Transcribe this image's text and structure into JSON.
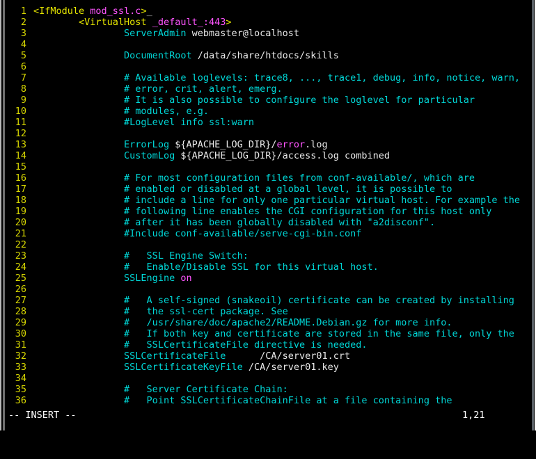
{
  "app": {
    "name": "vim",
    "mode_label": "-- INSERT --",
    "cursor_position": "1,21",
    "background_color": "#000000",
    "line_number_color": "#d7d700",
    "comment_color": "#00d7d7",
    "tag_color": "#e5e500",
    "value_color": "#ff55ff",
    "text_color": "#e8e8e8"
  },
  "scrollbars": {
    "left": {
      "name": "left-scrollbar",
      "thumb_color": "#6f6f6f"
    },
    "right": {
      "name": "right-scrollbar",
      "thumb_color": "#5a6066"
    }
  },
  "editor": {
    "first_line_number": 1,
    "last_line_number": 36,
    "lines": [
      {
        "n": "1",
        "tokens": [
          {
            "t": "plain",
            "s": ""
          },
          {
            "t": "tag",
            "s": "<IfModule "
          },
          {
            "t": "ident",
            "s": "mod_ssl.c"
          },
          {
            "t": "tag",
            "s": ">"
          },
          {
            "t": "cursor",
            "s": "_"
          }
        ]
      },
      {
        "n": "2",
        "tokens": [
          {
            "t": "plain",
            "s": "        "
          },
          {
            "t": "tag",
            "s": "<VirtualHost "
          },
          {
            "t": "ident",
            "s": "_default_:443"
          },
          {
            "t": "tag",
            "s": ">"
          }
        ]
      },
      {
        "n": "3",
        "tokens": [
          {
            "t": "plain",
            "s": "                "
          },
          {
            "t": "dir",
            "s": "ServerAdmin"
          },
          {
            "t": "plain",
            "s": " webmaster@localhost"
          }
        ]
      },
      {
        "n": "4",
        "tokens": [
          {
            "t": "plain",
            "s": ""
          }
        ]
      },
      {
        "n": "5",
        "tokens": [
          {
            "t": "plain",
            "s": "                "
          },
          {
            "t": "dir",
            "s": "DocumentRoot"
          },
          {
            "t": "plain",
            "s": " /data/share/htdocs/skills"
          }
        ]
      },
      {
        "n": "6",
        "tokens": [
          {
            "t": "plain",
            "s": ""
          }
        ]
      },
      {
        "n": "7",
        "tokens": [
          {
            "t": "plain",
            "s": "                "
          },
          {
            "t": "comment",
            "s": "# Available loglevels: trace8, ..., trace1, debug, info, notice, warn,"
          }
        ]
      },
      {
        "n": "8",
        "tokens": [
          {
            "t": "plain",
            "s": "                "
          },
          {
            "t": "comment",
            "s": "# error, crit, alert, emerg."
          }
        ]
      },
      {
        "n": "9",
        "tokens": [
          {
            "t": "plain",
            "s": "                "
          },
          {
            "t": "comment",
            "s": "# It is also possible to configure the loglevel for particular"
          }
        ]
      },
      {
        "n": "10",
        "tokens": [
          {
            "t": "plain",
            "s": "                "
          },
          {
            "t": "comment",
            "s": "# modules, e.g."
          }
        ]
      },
      {
        "n": "11",
        "tokens": [
          {
            "t": "plain",
            "s": "                "
          },
          {
            "t": "comment",
            "s": "#LogLevel info ssl:warn"
          }
        ]
      },
      {
        "n": "12",
        "tokens": [
          {
            "t": "plain",
            "s": ""
          }
        ]
      },
      {
        "n": "13",
        "tokens": [
          {
            "t": "plain",
            "s": "                "
          },
          {
            "t": "dir",
            "s": "ErrorLog"
          },
          {
            "t": "plain",
            "s": " ${APACHE_LOG_DIR}/"
          },
          {
            "t": "val",
            "s": "error"
          },
          {
            "t": "plain",
            "s": ".log"
          }
        ]
      },
      {
        "n": "14",
        "tokens": [
          {
            "t": "plain",
            "s": "                "
          },
          {
            "t": "dir",
            "s": "CustomLog"
          },
          {
            "t": "plain",
            "s": " ${APACHE_LOG_DIR}/access.log combined"
          }
        ]
      },
      {
        "n": "15",
        "tokens": [
          {
            "t": "plain",
            "s": ""
          }
        ]
      },
      {
        "n": "16",
        "tokens": [
          {
            "t": "plain",
            "s": "                "
          },
          {
            "t": "comment",
            "s": "# For most configuration files from conf-available/, which are"
          }
        ]
      },
      {
        "n": "17",
        "tokens": [
          {
            "t": "plain",
            "s": "                "
          },
          {
            "t": "comment",
            "s": "# enabled or disabled at a global level, it is possible to"
          }
        ]
      },
      {
        "n": "18",
        "tokens": [
          {
            "t": "plain",
            "s": "                "
          },
          {
            "t": "comment",
            "s": "# include a line for only one particular virtual host. For example the"
          }
        ]
      },
      {
        "n": "19",
        "tokens": [
          {
            "t": "plain",
            "s": "                "
          },
          {
            "t": "comment",
            "s": "# following line enables the CGI configuration for this host only"
          }
        ]
      },
      {
        "n": "20",
        "tokens": [
          {
            "t": "plain",
            "s": "                "
          },
          {
            "t": "comment",
            "s": "# after it has been globally disabled with \"a2disconf\"."
          }
        ]
      },
      {
        "n": "21",
        "tokens": [
          {
            "t": "plain",
            "s": "                "
          },
          {
            "t": "comment",
            "s": "#Include conf-available/serve-cgi-bin.conf"
          }
        ]
      },
      {
        "n": "22",
        "tokens": [
          {
            "t": "plain",
            "s": ""
          }
        ]
      },
      {
        "n": "23",
        "tokens": [
          {
            "t": "plain",
            "s": "                "
          },
          {
            "t": "comment",
            "s": "#   SSL Engine Switch:"
          }
        ]
      },
      {
        "n": "24",
        "tokens": [
          {
            "t": "plain",
            "s": "                "
          },
          {
            "t": "comment",
            "s": "#   Enable/Disable SSL for this virtual host."
          }
        ]
      },
      {
        "n": "25",
        "tokens": [
          {
            "t": "plain",
            "s": "                "
          },
          {
            "t": "dir",
            "s": "SSLEngine"
          },
          {
            "t": "plain",
            "s": " "
          },
          {
            "t": "val",
            "s": "on"
          }
        ]
      },
      {
        "n": "26",
        "tokens": [
          {
            "t": "plain",
            "s": ""
          }
        ]
      },
      {
        "n": "27",
        "tokens": [
          {
            "t": "plain",
            "s": "                "
          },
          {
            "t": "comment",
            "s": "#   A self-signed (snakeoil) certificate can be created by installing"
          }
        ]
      },
      {
        "n": "28",
        "tokens": [
          {
            "t": "plain",
            "s": "                "
          },
          {
            "t": "comment",
            "s": "#   the ssl-cert package. See"
          }
        ]
      },
      {
        "n": "29",
        "tokens": [
          {
            "t": "plain",
            "s": "                "
          },
          {
            "t": "comment",
            "s": "#   /usr/share/doc/apache2/README.Debian.gz for more info."
          }
        ]
      },
      {
        "n": "30",
        "tokens": [
          {
            "t": "plain",
            "s": "                "
          },
          {
            "t": "comment",
            "s": "#   If both key and certificate are stored in the same file, only the"
          }
        ]
      },
      {
        "n": "31",
        "tokens": [
          {
            "t": "plain",
            "s": "                "
          },
          {
            "t": "comment",
            "s": "#   SSLCertificateFile directive is needed."
          }
        ]
      },
      {
        "n": "32",
        "tokens": [
          {
            "t": "plain",
            "s": "                "
          },
          {
            "t": "dir",
            "s": "SSLCertificateFile"
          },
          {
            "t": "plain",
            "s": "      /CA/server01.crt"
          }
        ]
      },
      {
        "n": "33",
        "tokens": [
          {
            "t": "plain",
            "s": "                "
          },
          {
            "t": "dir",
            "s": "SSLCertificateKeyFile"
          },
          {
            "t": "plain",
            "s": " /CA/server01.key"
          }
        ]
      },
      {
        "n": "34",
        "tokens": [
          {
            "t": "plain",
            "s": ""
          }
        ]
      },
      {
        "n": "35",
        "tokens": [
          {
            "t": "plain",
            "s": "                "
          },
          {
            "t": "comment",
            "s": "#   Server Certificate Chain:"
          }
        ]
      },
      {
        "n": "36",
        "tokens": [
          {
            "t": "plain",
            "s": "                "
          },
          {
            "t": "comment",
            "s": "#   Point SSLCertificateChainFile at a file containing the"
          }
        ]
      }
    ]
  }
}
